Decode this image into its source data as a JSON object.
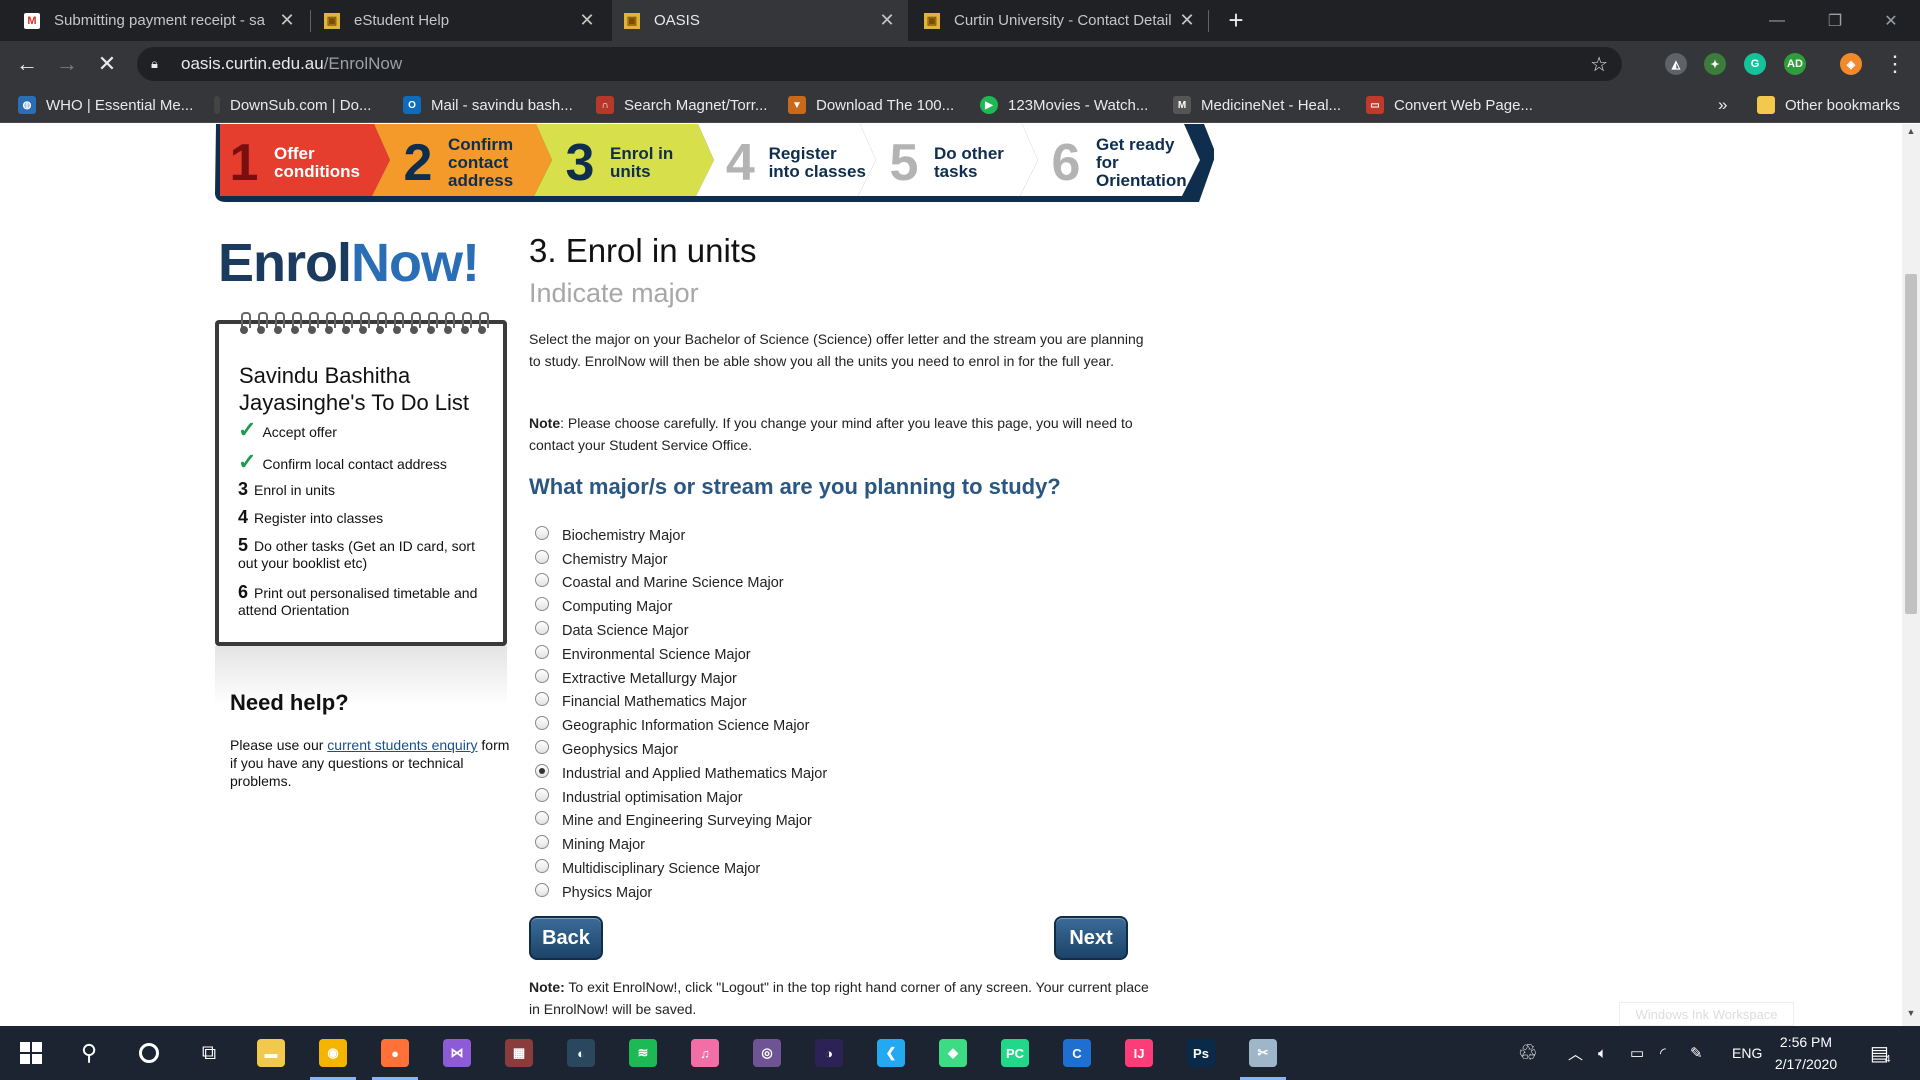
{
  "browser": {
    "tabs": [
      {
        "title": "Submitting payment receipt - sa",
        "favicon": "gmail-icon",
        "color": "#d93025",
        "active": false
      },
      {
        "title": "eStudent Help",
        "favicon": "curtin-icon",
        "color": "#e0b43b",
        "active": false
      },
      {
        "title": "OASIS",
        "favicon": "curtin-icon",
        "color": "#e0b43b",
        "active": true
      },
      {
        "title": "Curtin University - Contact Detail",
        "favicon": "curtin-icon",
        "color": "#e0b43b",
        "active": false
      }
    ],
    "url": {
      "host": "oasis.curtin.edu.au",
      "path": "/EnrolNow"
    },
    "bookmarks": [
      {
        "label": "WHO | Essential Me...",
        "color": "#2a6fb5"
      },
      {
        "label": "DownSub.com | Do...",
        "color": "#444"
      },
      {
        "label": "Mail - savindu bash...",
        "color": "#0f6cbd"
      },
      {
        "label": "Search Magnet/Torr...",
        "color": "#b5382a"
      },
      {
        "label": "Download The 100...",
        "color": "#c96a1b"
      },
      {
        "label": "123Movies - Watch...",
        "color": "#1db954"
      },
      {
        "label": "MedicineNet - Heal...",
        "color": "#555"
      },
      {
        "label": "Convert Web Page...",
        "color": "#c0392b"
      }
    ],
    "bookmarks_overflow": "»",
    "other_bookmarks": "Other bookmarks"
  },
  "steps": [
    {
      "num": "1",
      "label": "Offer conditions",
      "color": "#e53e2f"
    },
    {
      "num": "2",
      "label": "Confirm contact address",
      "color": "#f39a2b"
    },
    {
      "num": "3",
      "label": "Enrol in units",
      "color": "#d7e04a"
    },
    {
      "num": "4",
      "label": "Register into classes",
      "color": "#ffffff"
    },
    {
      "num": "5",
      "label": "Do other tasks",
      "color": "#ffffff"
    },
    {
      "num": "6",
      "label": "Get ready for Orientation",
      "color": "#ffffff"
    }
  ],
  "logo": {
    "part1": "Enrol",
    "part2": "Now!"
  },
  "todo": {
    "title": "Savindu Bashitha Jayasinghe's To Do List",
    "items": [
      {
        "mark": "✓",
        "text": "Accept offer",
        "done": true
      },
      {
        "mark": "✓",
        "text": "Confirm local contact address",
        "done": true
      },
      {
        "mark": "3",
        "text": "Enrol in units",
        "done": false
      },
      {
        "mark": "4",
        "text": "Register into classes",
        "done": false
      },
      {
        "mark": "5",
        "text": "Do other tasks (Get an ID card, sort out your booklist etc)",
        "done": false
      },
      {
        "mark": "6",
        "text": "Print out personalised timetable and attend Orientation",
        "done": false
      }
    ]
  },
  "help": {
    "title": "Need help?",
    "before_link": "Please use our ",
    "link": "current students enquiry",
    "after_link": " form if you have any questions or technical problems."
  },
  "main": {
    "title": "3. Enrol in units",
    "subtitle": "Indicate major",
    "intro": "Select the major on your Bachelor of Science (Science) offer letter and the stream you are planning to study. EnrolNow will then be able show you all the units you need to enrol in for the full year.",
    "note_label": "Note",
    "note_text": ": Please choose carefully. If you change your mind after you leave this page, you will need to contact your Student Service Office.",
    "question": "What major/s or stream are you planning to study?",
    "options": [
      "Biochemistry Major",
      "Chemistry Major",
      "Coastal and Marine Science Major",
      "Computing Major",
      "Data Science Major",
      "Environmental Science Major",
      "Extractive Metallurgy Major",
      "Financial Mathematics Major",
      "Geographic Information Science Major",
      "Geophysics Major",
      "Industrial and Applied Mathematics Major",
      "Industrial optimisation Major",
      "Mine and Engineering Surveying Major",
      "Mining Major",
      "Multidisciplinary Science Major",
      "Physics Major"
    ],
    "selected_option": "Industrial and Applied Mathematics Major",
    "back_label": "Back",
    "next_label": "Next",
    "exit_note_label": "Note:",
    "exit_note_text": " To exit EnrolNow!, click \"Logout\" in the top right hand corner of any screen. Your current place in EnrolNow! will be saved.",
    "ink_workspace": "Windows Ink Workspace"
  },
  "taskbar": {
    "apps": [
      {
        "name": "file-explorer-icon",
        "color": "#f2c94c",
        "glyph": "▬"
      },
      {
        "name": "chrome-icon",
        "color": "#f4b400",
        "glyph": "◉"
      },
      {
        "name": "firefox-icon",
        "color": "#ff7139",
        "glyph": "●"
      },
      {
        "name": "visual-studio-icon",
        "color": "#8e5bd6",
        "glyph": "⋈"
      },
      {
        "name": "winrar-icon",
        "color": "#8a3b3b",
        "glyph": "▦"
      },
      {
        "name": "steam-icon",
        "color": "#2a475e",
        "glyph": "◐"
      },
      {
        "name": "spotify-icon",
        "color": "#1db954",
        "glyph": "≋"
      },
      {
        "name": "itunes-icon",
        "color": "#f16fa6",
        "glyph": "♫"
      },
      {
        "name": "github-icon",
        "color": "#6e5494",
        "glyph": "◎"
      },
      {
        "name": "eclipse-icon",
        "color": "#2c2255",
        "glyph": "◑"
      },
      {
        "name": "vscode-icon",
        "color": "#23a9f2",
        "glyph": "❮"
      },
      {
        "name": "android-studio-icon",
        "color": "#3ddc84",
        "glyph": "◆"
      },
      {
        "name": "pycharm-icon",
        "color": "#21d789",
        "glyph": "PC"
      },
      {
        "name": "ccleaner-icon",
        "color": "#1f6fd1",
        "glyph": "C"
      },
      {
        "name": "intellij-icon",
        "color": "#fc3d7a",
        "glyph": "IJ"
      },
      {
        "name": "photoshop-icon",
        "color": "#0a2a4a",
        "glyph": "Ps"
      },
      {
        "name": "snipping-tool-icon",
        "color": "#9fb6c9",
        "glyph": "✂"
      }
    ],
    "language": "ENG",
    "time": "2:56 PM",
    "date": "2/17/2020",
    "notifications": "4"
  }
}
